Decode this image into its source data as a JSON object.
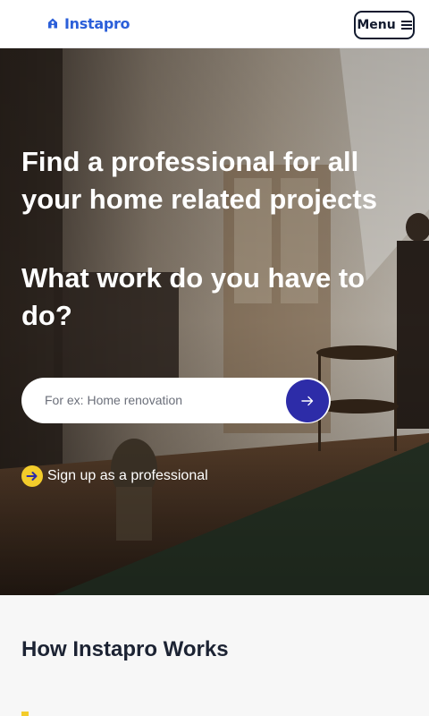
{
  "header": {
    "logo_text": "Instapro",
    "menu_label": "Menu",
    "brand_color": "#2b5fd9"
  },
  "hero": {
    "title": "Find a professional for all your home related projects",
    "question": "What work do you have to do?",
    "search": {
      "placeholder": "For ex: Home renovation",
      "value": "",
      "button_icon": "arrow-right-icon",
      "button_color": "#2d2ca8"
    },
    "signup": {
      "icon": "arrow-right-circle-icon",
      "icon_color": "#f3cc2b",
      "label": "Sign up as a professional"
    }
  },
  "how_it_works": {
    "title": "How Instapro Works"
  }
}
